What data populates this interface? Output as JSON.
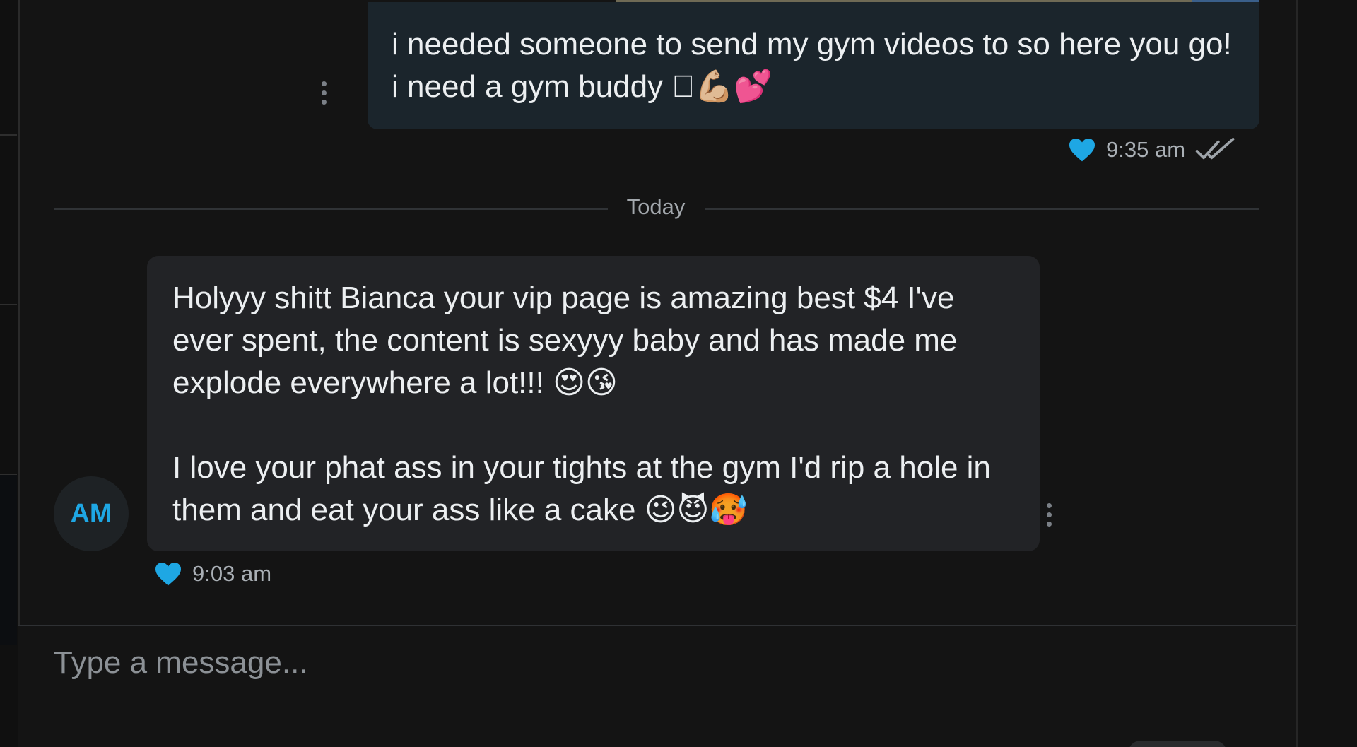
{
  "messages": [
    {
      "direction": "outgoing",
      "text": "i needed someone to send my gym videos to so here you go! i need a gym buddy 🏻💪🏼💕",
      "time": "9:35 am",
      "liked": true,
      "read_receipt": "double-check"
    },
    {
      "direction": "incoming",
      "sender_initials": "AM",
      "paragraphs": [
        "Holyyy shitt Bianca your vip page is amazing best $4 I've ever spent, the content is sexyyy baby and has made me explode everywhere a lot!!! 😍😘",
        "I love your phat ass in your tights at the gym I'd rip a hole in them and eat your ass like a cake 😉😈🥵"
      ],
      "time": "9:03 am",
      "liked": true
    }
  ],
  "date_divider": "Today",
  "composer": {
    "placeholder": "Type a message..."
  },
  "colors": {
    "accent": "#1ea7e4",
    "background": "#141414",
    "outgoing_bubble": "#1b252c",
    "incoming_bubble": "#222326"
  },
  "icons": [
    "heart-icon",
    "double-check-icon",
    "more-vert-icon"
  ]
}
